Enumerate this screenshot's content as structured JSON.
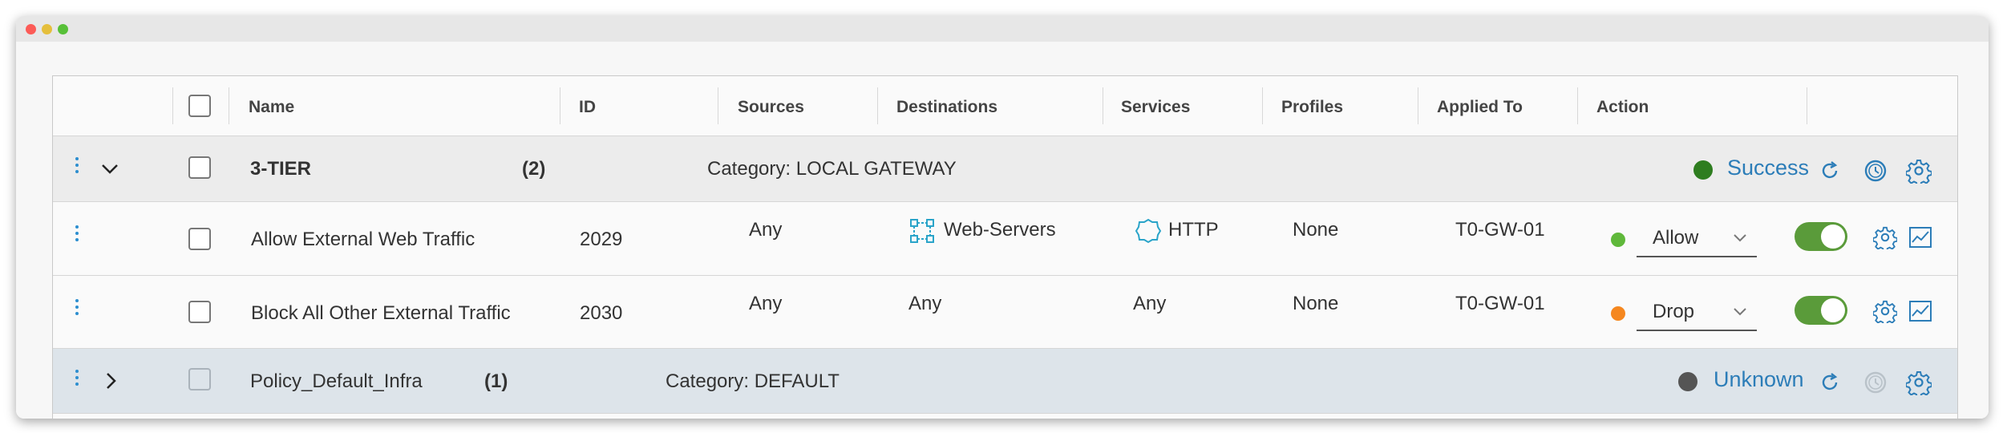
{
  "colors": {
    "accent": "#2c7db8",
    "success": "#2e7d1f",
    "unknown": "#555555",
    "allow": "#5fb83a",
    "drop": "#f5871f",
    "toggle": "#5a9b3a"
  },
  "table": {
    "headers": [
      "Name",
      "ID",
      "Sources",
      "Destinations",
      "Services",
      "Profiles",
      "Applied To",
      "Action"
    ]
  },
  "sections": [
    {
      "name": "3-TIER",
      "count": "(2)",
      "category": "Category: LOCAL GATEWAY",
      "status": "Success",
      "expanded": true
    },
    {
      "name": "Policy_Default_Infra",
      "count": "(1)",
      "category": "Category: DEFAULT",
      "status": "Unknown",
      "expanded": false
    }
  ],
  "rules": [
    {
      "name": "Allow External Web Traffic",
      "id": "2029",
      "sources": "Any",
      "destinations": "Web-Servers",
      "services": "HTTP",
      "profiles": "None",
      "applied_to": "T0-GW-01",
      "action": "Allow",
      "enabled": true
    },
    {
      "name": "Block All Other External Traffic",
      "id": "2030",
      "sources": "Any",
      "destinations": "Any",
      "services": "Any",
      "profiles": "None",
      "applied_to": "T0-GW-01",
      "action": "Drop",
      "enabled": true
    }
  ],
  "icons": [
    "kebab-menu-icon",
    "chevron-down-icon",
    "chevron-right-icon",
    "refresh-icon",
    "history-icon",
    "gear-icon",
    "group-icon",
    "service-icon",
    "stats-icon"
  ]
}
